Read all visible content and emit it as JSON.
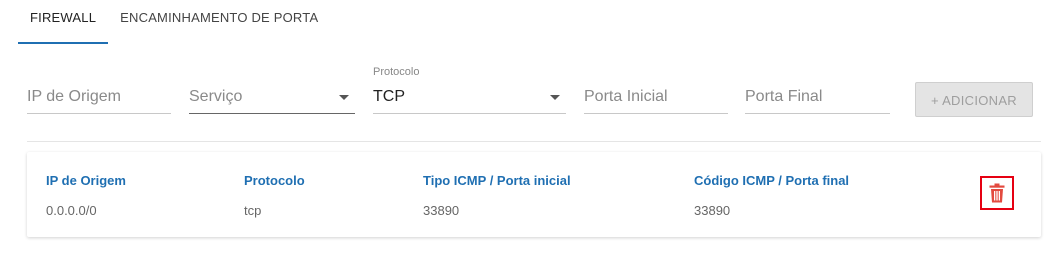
{
  "tabs": [
    {
      "label": "FIREWALL",
      "active": true
    },
    {
      "label": "ENCAMINHAMENTO DE PORTA",
      "active": false
    }
  ],
  "form": {
    "ip_origem": {
      "placeholder": "IP de Origem",
      "value": ""
    },
    "servico": {
      "placeholder": "Serviço",
      "selected": ""
    },
    "protocolo": {
      "label": "Protocolo",
      "selected": "TCP"
    },
    "porta_inicial": {
      "placeholder": "Porta Inicial",
      "value": ""
    },
    "porta_final": {
      "placeholder": "Porta Final",
      "value": ""
    },
    "add_button": {
      "label": "+ ADICIONAR",
      "disabled": true
    }
  },
  "rule": {
    "headers": {
      "ip_origem": "IP de Origem",
      "protocolo": "Protocolo",
      "tipo_icmp": "Tipo ICMP / Porta inicial",
      "codigo_icmp": "Código ICMP / Porta final"
    },
    "values": {
      "ip_origem": "0.0.0.0/0",
      "protocolo": "tcp",
      "tipo_icmp": "33890",
      "codigo_icmp": "33890"
    },
    "delete_icon": "trash-icon"
  },
  "colors": {
    "accent": "#1f6fb2",
    "delete_highlight": "#e60012",
    "trash_icon": "#e34a3f"
  }
}
